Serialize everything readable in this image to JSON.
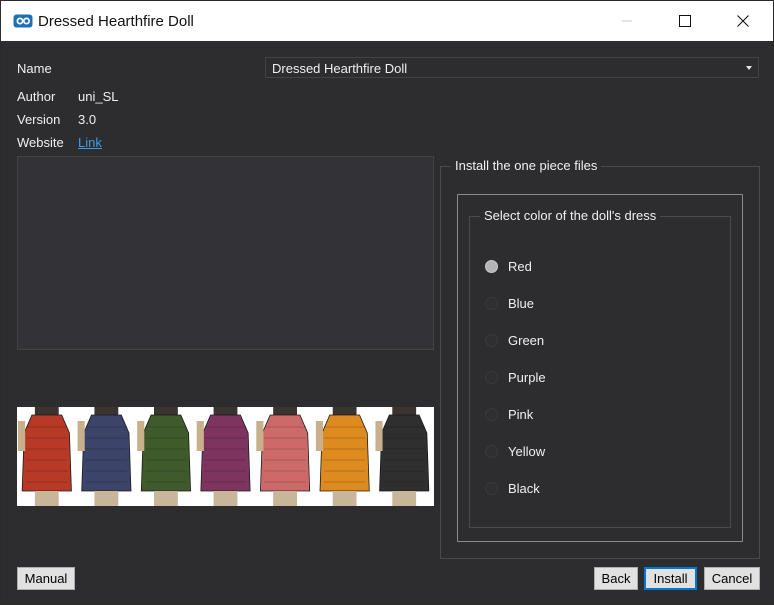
{
  "window": {
    "title": "Dressed Hearthfire Doll"
  },
  "info": {
    "name_label": "Name",
    "name_value": "Dressed Hearthfire Doll",
    "author_label": "Author",
    "author_value": "uni_SL",
    "version_label": "Version",
    "version_value": "3.0",
    "website_label": "Website",
    "website_link": "Link"
  },
  "options": {
    "group_title": "Install the one piece files",
    "inner_group_title": "Select color of the doll's dress",
    "selected": "Red",
    "items": [
      "Red",
      "Blue",
      "Green",
      "Purple",
      "Pink",
      "Yellow",
      "Black"
    ]
  },
  "preview": {
    "dress_colors": [
      "#b83a26",
      "#3c4469",
      "#3f5b2c",
      "#7d3560",
      "#cc6a6a",
      "#dd8a1e",
      "#2f2f2f"
    ]
  },
  "buttons": {
    "manual": "Manual",
    "back": "Back",
    "install": "Install",
    "cancel": "Cancel"
  },
  "icons": {
    "app": "mod-organizer-icon",
    "minimize": "minimize-icon",
    "maximize": "maximize-icon",
    "close": "close-icon",
    "dropdown": "chevron-down-icon"
  }
}
